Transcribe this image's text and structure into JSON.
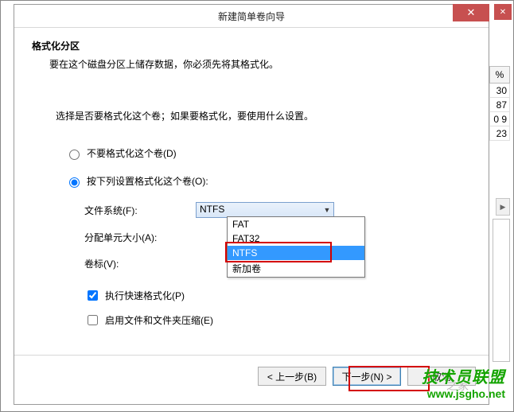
{
  "window": {
    "title": "新建简单卷向导",
    "close_x": "✕"
  },
  "page": {
    "heading": "格式化分区",
    "subtext": "要在这个磁盘分区上储存数据，你必须先将其格式化。",
    "instruction": "选择是否要格式化这个卷；如果要格式化，要使用什么设置。"
  },
  "radios": {
    "no_format": "不要格式化这个卷(D)",
    "do_format": "按下列设置格式化这个卷(O):"
  },
  "form": {
    "fs_label": "文件系统(F):",
    "fs_value": "NTFS",
    "alloc_label": "分配单元大小(A):",
    "volume_label_label": "卷标(V):",
    "volume_label_value": "新加卷",
    "quick_format": "执行快速格式化(P)",
    "compression": "启用文件和文件夹压缩(E)"
  },
  "dropdown": {
    "options": [
      "FAT",
      "FAT32",
      "NTFS"
    ],
    "selected": "NTFS"
  },
  "buttons": {
    "back": "< 上一步(B)",
    "next": "下一步(N) >",
    "cancel": "取消"
  },
  "side_table": {
    "header": "%",
    "cells": [
      "30",
      "87",
      "0 9",
      "23"
    ]
  },
  "watermark": {
    "big": "技术员联盟",
    "url": "www.jsgho.net",
    "grey": "之家"
  }
}
